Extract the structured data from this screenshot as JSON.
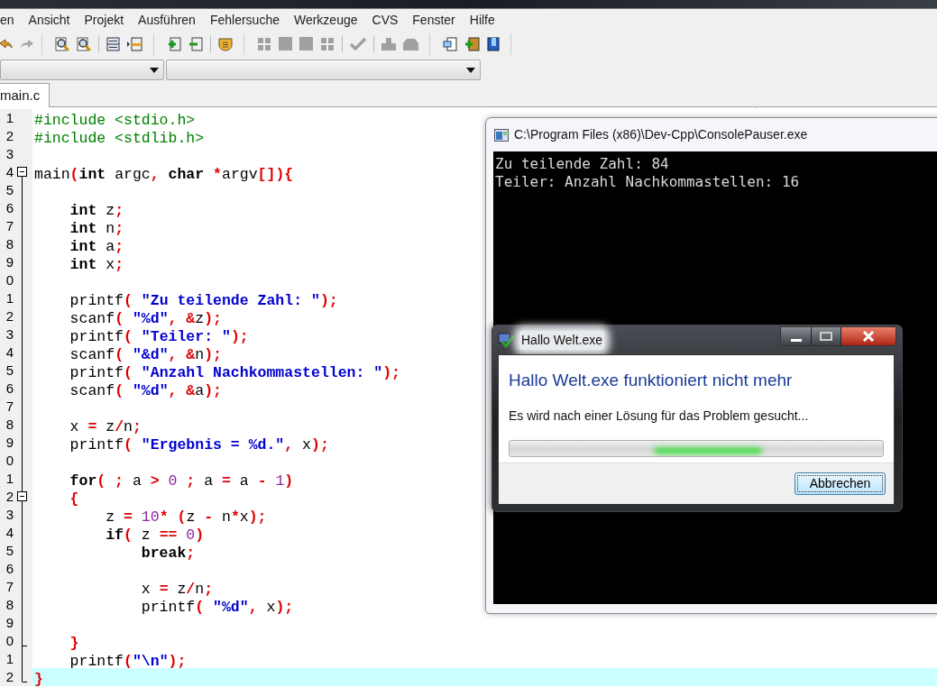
{
  "menu": [
    "en",
    "Ansicht",
    "Projekt",
    "Ausführen",
    "Fehlersuche",
    "Werkzeuge",
    "CVS",
    "Fenster",
    "Hilfe"
  ],
  "tabs": [
    {
      "label": "main.c",
      "selected": true
    }
  ],
  "editor": {
    "lines": [
      {
        "number": "1",
        "selected": false,
        "kind": "plain",
        "tokens": [
          {
            "kind": "pre",
            "text": "#include <stdio.h>"
          }
        ]
      },
      {
        "number": "2",
        "selected": false,
        "kind": "plain",
        "tokens": [
          {
            "kind": "pre",
            "text": "#include <stdlib.h>"
          }
        ]
      },
      {
        "number": "3",
        "selected": false,
        "kind": "plain"
      },
      {
        "number": "4",
        "selected": false,
        "kind": "fold_start",
        "tokens": [
          {
            "kind": "plain",
            "text": "main"
          },
          {
            "kind": "sym",
            "text": "("
          },
          {
            "kind": "kw",
            "text": "int"
          },
          {
            "kind": "plain",
            "text": " argc"
          },
          {
            "kind": "sym",
            "text": ", "
          },
          {
            "kind": "kw",
            "text": "char"
          },
          {
            "kind": "sym",
            "text": " *"
          },
          {
            "kind": "plain",
            "text": "argv"
          },
          {
            "kind": "sym",
            "text": "[]){"
          }
        ]
      },
      {
        "number": "5",
        "selected": false,
        "kind": "plain"
      },
      {
        "number": "6",
        "selected": false,
        "kind": "plain",
        "tokens": [
          {
            "kind": "kw",
            "text": "    int"
          },
          {
            "kind": "plain",
            "text": " z"
          },
          {
            "kind": "sym",
            "text": ";"
          }
        ]
      },
      {
        "number": "7",
        "selected": false,
        "kind": "plain",
        "tokens": [
          {
            "kind": "kw",
            "text": "    int"
          },
          {
            "kind": "plain",
            "text": " n"
          },
          {
            "kind": "sym",
            "text": ";"
          }
        ]
      },
      {
        "number": "8",
        "selected": false,
        "kind": "plain",
        "tokens": [
          {
            "kind": "kw",
            "text": "    int"
          },
          {
            "kind": "plain",
            "text": " a"
          },
          {
            "kind": "sym",
            "text": ";"
          }
        ]
      },
      {
        "number": "9",
        "selected": false,
        "kind": "plain",
        "tokens": [
          {
            "kind": "kw",
            "text": "    int"
          },
          {
            "kind": "plain",
            "text": " x"
          },
          {
            "kind": "sym",
            "text": ";"
          }
        ]
      },
      {
        "number": "0",
        "selected": false,
        "kind": "plain"
      },
      {
        "number": "1",
        "selected": false,
        "kind": "plain",
        "tokens": [
          {
            "kind": "plain",
            "text": "    printf"
          },
          {
            "kind": "sym",
            "text": "( "
          },
          {
            "kind": "str",
            "text": "\"Zu teilende Zahl: \""
          },
          {
            "kind": "sym",
            "text": ");"
          }
        ]
      },
      {
        "number": "2",
        "selected": false,
        "kind": "plain",
        "tokens": [
          {
            "kind": "plain",
            "text": "    scanf"
          },
          {
            "kind": "sym",
            "text": "( "
          },
          {
            "kind": "str",
            "text": "\"%d\""
          },
          {
            "kind": "sym",
            "text": ", &"
          },
          {
            "kind": "plain",
            "text": "z"
          },
          {
            "kind": "sym",
            "text": ");"
          }
        ]
      },
      {
        "number": "3",
        "selected": false,
        "kind": "plain",
        "tokens": [
          {
            "kind": "plain",
            "text": "    printf"
          },
          {
            "kind": "sym",
            "text": "( "
          },
          {
            "kind": "str",
            "text": "\"Teiler: \""
          },
          {
            "kind": "sym",
            "text": ");"
          }
        ]
      },
      {
        "number": "4",
        "selected": false,
        "kind": "plain",
        "tokens": [
          {
            "kind": "plain",
            "text": "    scanf"
          },
          {
            "kind": "sym",
            "text": "( "
          },
          {
            "kind": "str",
            "text": "\"&d\""
          },
          {
            "kind": "sym",
            "text": ", &"
          },
          {
            "kind": "plain",
            "text": "n"
          },
          {
            "kind": "sym",
            "text": ");"
          }
        ]
      },
      {
        "number": "5",
        "selected": false,
        "kind": "plain",
        "tokens": [
          {
            "kind": "plain",
            "text": "    printf"
          },
          {
            "kind": "sym",
            "text": "( "
          },
          {
            "kind": "str",
            "text": "\"Anzahl Nachkommastellen: \""
          },
          {
            "kind": "sym",
            "text": ");"
          }
        ]
      },
      {
        "number": "6",
        "selected": false,
        "kind": "plain",
        "tokens": [
          {
            "kind": "plain",
            "text": "    scanf"
          },
          {
            "kind": "sym",
            "text": "( "
          },
          {
            "kind": "str",
            "text": "\"%d\""
          },
          {
            "kind": "sym",
            "text": ", &"
          },
          {
            "kind": "plain",
            "text": "a"
          },
          {
            "kind": "sym",
            "text": ");"
          }
        ]
      },
      {
        "number": "7",
        "selected": false,
        "kind": "plain"
      },
      {
        "number": "8",
        "selected": false,
        "kind": "plain",
        "tokens": [
          {
            "kind": "plain",
            "text": "    x "
          },
          {
            "kind": "sym",
            "text": "="
          },
          {
            "kind": "plain",
            "text": " z"
          },
          {
            "kind": "sym",
            "text": "/"
          },
          {
            "kind": "plain",
            "text": "n"
          },
          {
            "kind": "sym",
            "text": ";"
          }
        ]
      },
      {
        "number": "9",
        "selected": false,
        "kind": "plain",
        "tokens": [
          {
            "kind": "plain",
            "text": "    printf"
          },
          {
            "kind": "sym",
            "text": "( "
          },
          {
            "kind": "str",
            "text": "\"Ergebnis = %d.\""
          },
          {
            "kind": "sym",
            "text": ","
          },
          {
            "kind": "plain",
            "text": " x"
          },
          {
            "kind": "sym",
            "text": ");"
          }
        ]
      },
      {
        "number": "0",
        "selected": false,
        "kind": "plain"
      },
      {
        "number": "1",
        "selected": false,
        "kind": "plain",
        "tokens": [
          {
            "kind": "kw",
            "text": "    for"
          },
          {
            "kind": "sym",
            "text": "( ;"
          },
          {
            "kind": "plain",
            "text": " a "
          },
          {
            "kind": "sym",
            "text": ">"
          },
          {
            "kind": "num",
            "text": " 0"
          },
          {
            "kind": "sym",
            "text": " ;"
          },
          {
            "kind": "plain",
            "text": " a "
          },
          {
            "kind": "sym",
            "text": "="
          },
          {
            "kind": "plain",
            "text": " a "
          },
          {
            "kind": "sym",
            "text": "-"
          },
          {
            "kind": "num",
            "text": " 1"
          },
          {
            "kind": "sym",
            "text": ")"
          }
        ]
      },
      {
        "number": "2",
        "selected": false,
        "kind": "fold_start",
        "tokens": [
          {
            "kind": "sym",
            "text": "    {"
          }
        ]
      },
      {
        "number": "3",
        "selected": false,
        "kind": "plain",
        "tokens": [
          {
            "kind": "plain",
            "text": "        z "
          },
          {
            "kind": "sym",
            "text": "="
          },
          {
            "kind": "num",
            "text": " 10"
          },
          {
            "kind": "sym",
            "text": "* ("
          },
          {
            "kind": "plain",
            "text": "z "
          },
          {
            "kind": "sym",
            "text": "-"
          },
          {
            "kind": "plain",
            "text": " n"
          },
          {
            "kind": "sym",
            "text": "*"
          },
          {
            "kind": "plain",
            "text": "x"
          },
          {
            "kind": "sym",
            "text": ");"
          }
        ]
      },
      {
        "number": "4",
        "selected": false,
        "kind": "plain",
        "tokens": [
          {
            "kind": "kw",
            "text": "        if"
          },
          {
            "kind": "sym",
            "text": "("
          },
          {
            "kind": "plain",
            "text": " z "
          },
          {
            "kind": "sym",
            "text": "=="
          },
          {
            "kind": "num",
            "text": " 0"
          },
          {
            "kind": "sym",
            "text": ")"
          }
        ]
      },
      {
        "number": "5",
        "selected": false,
        "kind": "plain",
        "tokens": [
          {
            "kind": "kw",
            "text": "            break"
          },
          {
            "kind": "sym",
            "text": ";"
          }
        ]
      },
      {
        "number": "6",
        "selected": false,
        "kind": "plain"
      },
      {
        "number": "7",
        "selected": false,
        "kind": "plain",
        "tokens": [
          {
            "kind": "plain",
            "text": "            x "
          },
          {
            "kind": "sym",
            "text": "="
          },
          {
            "kind": "plain",
            "text": " z"
          },
          {
            "kind": "sym",
            "text": "/"
          },
          {
            "kind": "plain",
            "text": "n"
          },
          {
            "kind": "sym",
            "text": ";"
          }
        ]
      },
      {
        "number": "8",
        "selected": false,
        "kind": "plain",
        "tokens": [
          {
            "kind": "plain",
            "text": "            printf"
          },
          {
            "kind": "sym",
            "text": "( "
          },
          {
            "kind": "str",
            "text": "\"%d\""
          },
          {
            "kind": "sym",
            "text": ","
          },
          {
            "kind": "plain",
            "text": " x"
          },
          {
            "kind": "sym",
            "text": ");"
          }
        ]
      },
      {
        "number": "9",
        "selected": false,
        "kind": "plain"
      },
      {
        "number": "0",
        "selected": false,
        "kind": "fold_end",
        "tokens": [
          {
            "kind": "sym",
            "text": "    }"
          }
        ]
      },
      {
        "number": "1",
        "selected": false,
        "kind": "plain",
        "tokens": [
          {
            "kind": "plain",
            "text": "    printf"
          },
          {
            "kind": "sym",
            "text": "("
          },
          {
            "kind": "str",
            "text": "\"\\n\""
          },
          {
            "kind": "sym",
            "text": ");"
          }
        ]
      },
      {
        "number": "2",
        "selected": true,
        "kind": "fold_end",
        "tokens": [
          {
            "kind": "sym",
            "text": "}"
          }
        ]
      }
    ]
  },
  "console_window": {
    "title": "C:\\Program Files (x86)\\Dev-Cpp\\ConsolePauser.exe",
    "output": [
      "Zu teilende Zahl: 84",
      "Teiler: Anzahl Nachkommastellen: 16"
    ]
  },
  "error_dialog": {
    "title": "Hallo Welt.exe",
    "heading": "Hallo Welt.exe funktioniert nicht mehr",
    "message": "Es wird nach einer Lösung für das Problem gesucht...",
    "progress": {
      "running": true
    },
    "buttons": [
      {
        "label": "Abbrechen",
        "focused": true
      }
    ]
  }
}
